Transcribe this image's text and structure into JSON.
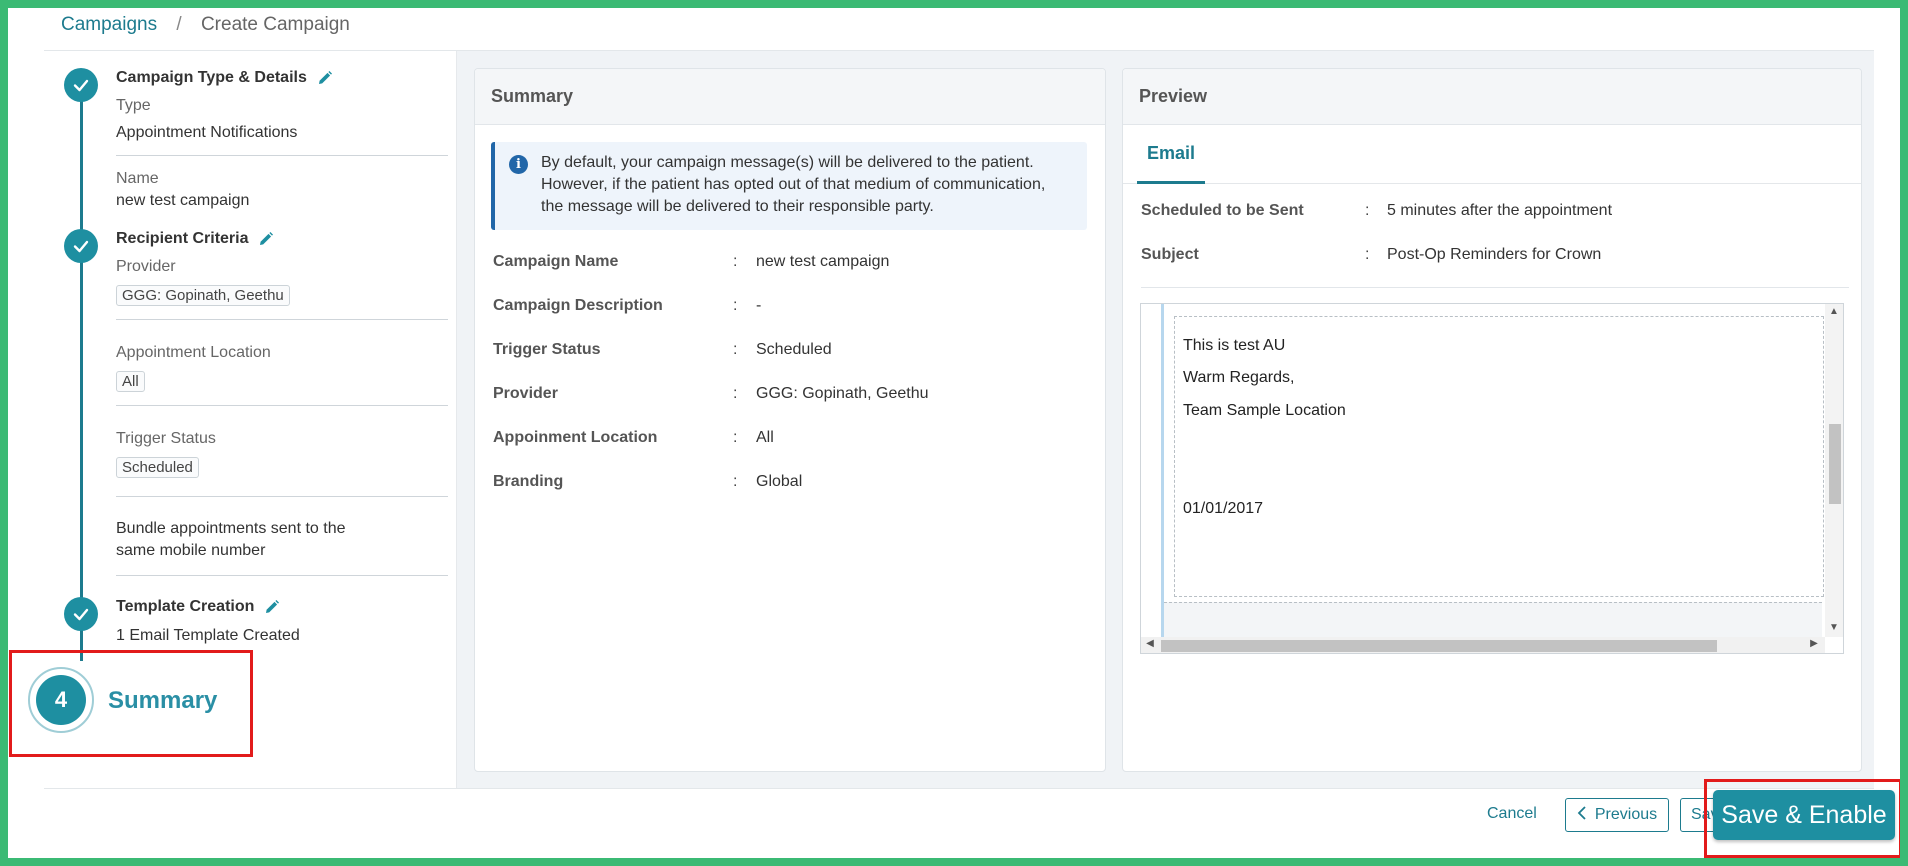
{
  "breadcrumb": {
    "root": "Campaigns",
    "separator": "/",
    "current": "Create Campaign"
  },
  "stepper": {
    "step1": {
      "title": "Campaign Type & Details",
      "type_label": "Type",
      "type_value": "Appointment Notifications",
      "name_label": "Name",
      "name_value": "new test campaign"
    },
    "step2": {
      "title": "Recipient Criteria",
      "provider_label": "Provider",
      "provider_value": "GGG: Gopinath, Geethu",
      "location_label": "Appointment Location",
      "location_value": "All",
      "trigger_label": "Trigger Status",
      "trigger_value": "Scheduled",
      "bundle_text_1": "Bundle appointments sent to the",
      "bundle_text_2": "same mobile number"
    },
    "step3": {
      "title": "Template Creation",
      "value": "1 Email Template Created"
    },
    "step4": {
      "number": "4",
      "title": "Summary"
    }
  },
  "summary": {
    "title": "Summary",
    "info_lines": [
      "By default, your campaign message(s) will be delivered to the patient.",
      "However, if the patient has opted out of that medium of communication,",
      "the message will be delivered to their responsible party."
    ],
    "rows": [
      {
        "label": "Campaign Name",
        "value": "new test campaign"
      },
      {
        "label": "Campaign Description",
        "value": "-"
      },
      {
        "label": "Trigger Status",
        "value": "Scheduled"
      },
      {
        "label": "Provider",
        "value": "GGG: Gopinath, Geethu"
      },
      {
        "label": "Appoinment Location",
        "value": "All"
      },
      {
        "label": "Branding",
        "value": "Global"
      }
    ]
  },
  "preview": {
    "title": "Preview",
    "tab": "Email",
    "rows": [
      {
        "label": "Scheduled to be Sent",
        "value": "5 minutes after the appointment"
      },
      {
        "label": "Subject",
        "value": "Post-Op Reminders for Crown"
      }
    ],
    "body_lines": [
      "This is test AU",
      "Warm Regards,",
      "Team Sample Location",
      "01/01/2017"
    ]
  },
  "footer": {
    "cancel": "Cancel",
    "previous": "Previous",
    "save_draft": "Save",
    "save_enable": "Save & Enable"
  },
  "colors": {
    "accent": "#1e8fa1",
    "highlight": "#e21b1b",
    "frame": "#3bba74"
  },
  "icons": [
    "check-icon",
    "pencil-icon",
    "info-icon",
    "chevron-left-icon",
    "scroll-up-icon",
    "scroll-down-icon",
    "scroll-left-icon",
    "scroll-right-icon"
  ]
}
